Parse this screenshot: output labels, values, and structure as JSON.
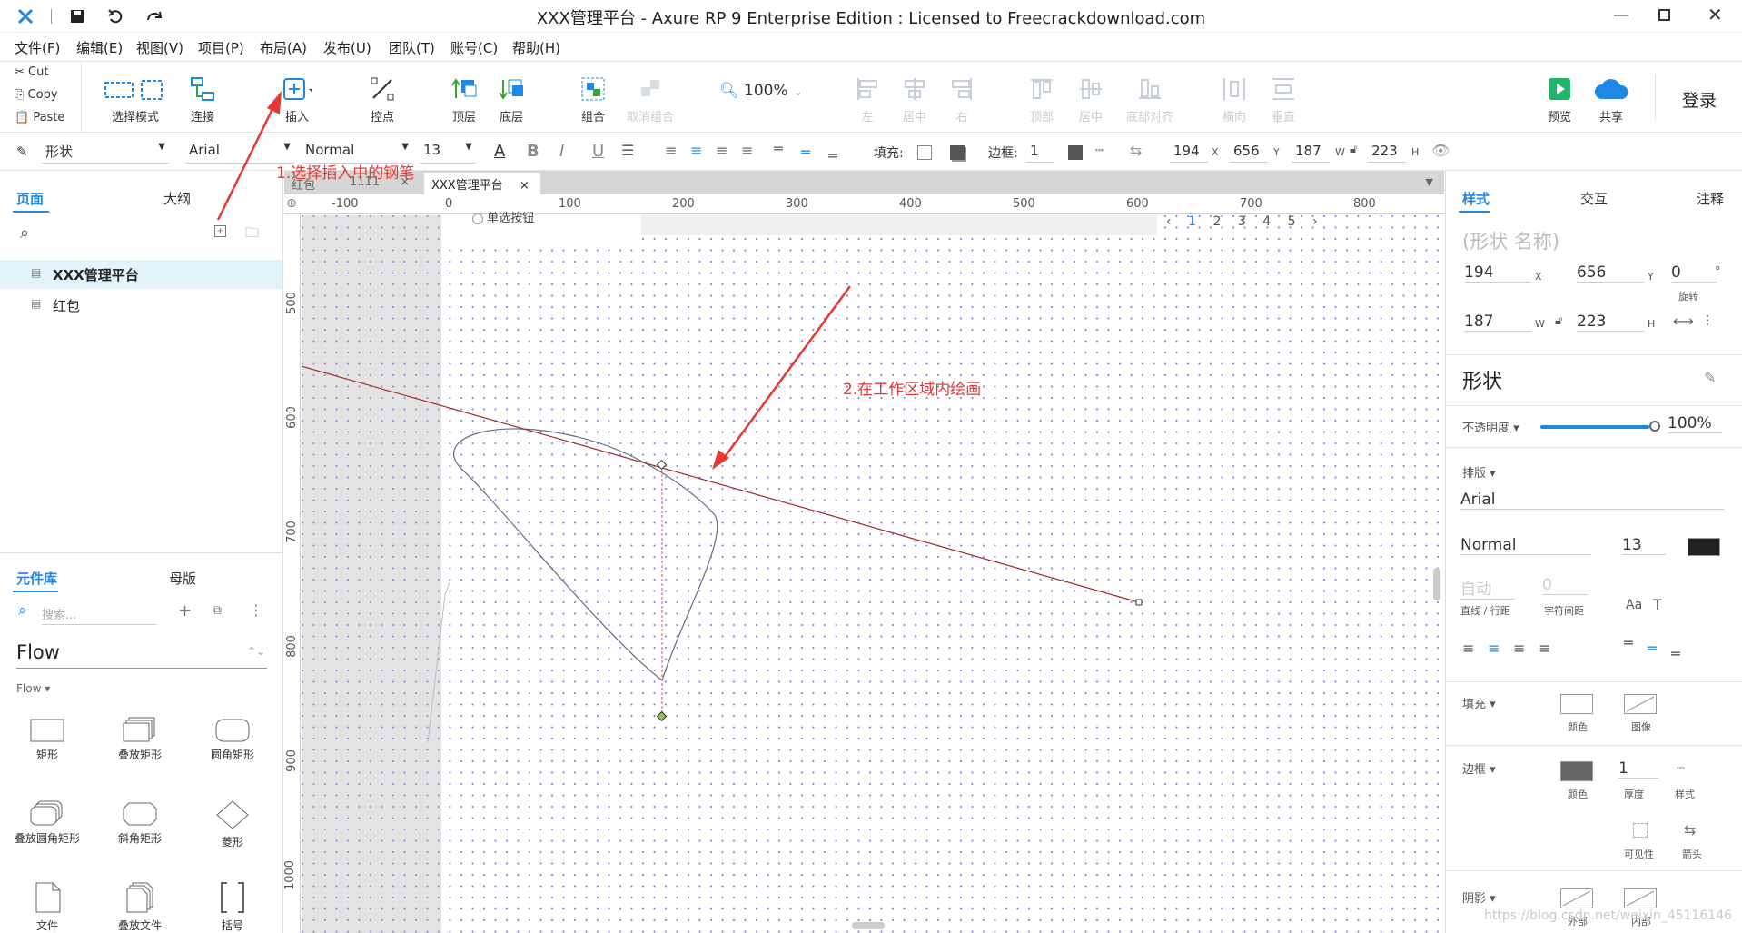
{
  "title": "XXX管理平台 - Axure RP 9 Enterprise Edition : Licensed to Freecrackdownload.com",
  "menu": [
    "文件(F)",
    "编辑(E)",
    "视图(V)",
    "项目(P)",
    "布局(A)",
    "发布(U)",
    "团队(T)",
    "账号(C)",
    "帮助(H)"
  ],
  "clipboard": {
    "cut": "Cut",
    "copy": "Copy",
    "paste": "Paste"
  },
  "toolbar": {
    "select_mode": "选择模式",
    "connect": "连接",
    "insert": "插入",
    "points": "控点",
    "front": "顶层",
    "back": "底层",
    "group": "组合",
    "ungroup": "取消组合",
    "zoom": "100%",
    "left": "左",
    "center": "居中",
    "right": "右",
    "top": "顶部",
    "middle": "居中",
    "bottom": "底部对齐",
    "horizontal": "横向",
    "vertical": "垂直",
    "preview": "预览",
    "share": "共享",
    "login": "登录"
  },
  "format": {
    "shape": "形状",
    "font": "Arial",
    "weight": "Normal",
    "size": "13",
    "fill": "填充:",
    "border": "边框:",
    "border_val": "1",
    "x": "194",
    "y": "656",
    "w": "187",
    "h": "223",
    "xl": "X",
    "yl": "Y",
    "wl": "W",
    "hl": "H"
  },
  "left": {
    "tab_pages": "页面",
    "tab_outline": "大纲",
    "pages": [
      "XXX管理平台",
      "红包"
    ],
    "tab_lib": "元件库",
    "tab_master": "母版",
    "search_placeholder": "搜索...",
    "library": "Flow",
    "library_sub": "Flow ▾",
    "widgets": [
      "矩形",
      "叠放矩形",
      "圆角矩形",
      "叠放圆角矩形",
      "斜角矩形",
      "菱形",
      "文件",
      "叠放文件",
      "括号"
    ]
  },
  "doc_tabs": [
    "红包",
    "1111",
    "XXX管理平台"
  ],
  "ruler_h": [
    "-100",
    "0",
    "100",
    "200",
    "300",
    "400",
    "500",
    "600",
    "700",
    "800"
  ],
  "ruler_v": [
    "500",
    "600",
    "700",
    "800",
    "900",
    "1000"
  ],
  "pager": [
    "1",
    "2",
    "3",
    "4",
    "5"
  ],
  "canvas_stub": "单选按钮",
  "annotations": {
    "a1": "1.选择插入中的钢笔",
    "a2": "2.在工作区域内绘画"
  },
  "right": {
    "tab_style": "样式",
    "tab_interact": "交互",
    "tab_note": "注释",
    "shape_name": "(形状 名称)",
    "x": "194",
    "y": "656",
    "rot": "0",
    "rot_unit": "°",
    "rot_label": "旋转",
    "w": "187",
    "h": "223",
    "xl": "X",
    "yl": "Y",
    "wl": "W",
    "hl": "H",
    "section": "形状",
    "opacity_label": "不透明度 ▾",
    "opacity": "100%",
    "typo_label": "排版 ▾",
    "font": "Arial",
    "weight": "Normal",
    "size": "13",
    "auto": "自动",
    "spacing": "0",
    "line_label": "直线 / 行距",
    "char_label": "字符间距",
    "fill_label": "填充 ▾",
    "fill_color": "颜色",
    "fill_image": "图像",
    "border_label": "边框 ▾",
    "border_color": "颜色",
    "border_thick": "1",
    "thick_label": "厚度",
    "style_label": "样式",
    "visible": "可见性",
    "arrow": "箭头",
    "shadow_label": "阴影 ▾",
    "shadow_out": "外部",
    "shadow_in": "内部"
  },
  "watermark": "https://blog.csdn.net/weixin_45116146",
  "colors": {
    "accent": "#1e88e5",
    "annotation": "#e53935",
    "grid_dot": "#3b46d6"
  }
}
